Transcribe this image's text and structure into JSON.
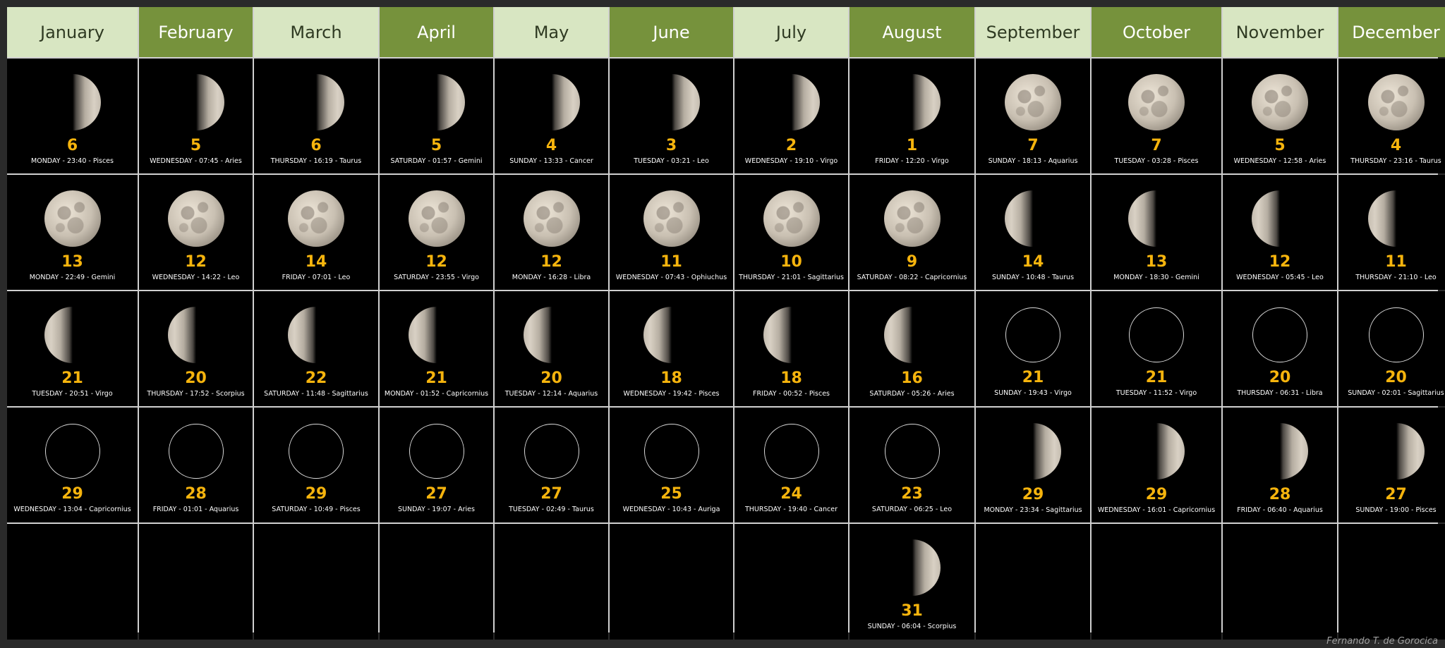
{
  "credit": "Fernando T. de Gorocica",
  "months": [
    {
      "name": "January",
      "style": "light",
      "phases": [
        {
          "day": "6",
          "info": "MONDAY - 23:40 - Pisces",
          "phase": "first"
        },
        {
          "day": "13",
          "info": "MONDAY - 22:49 - Gemini",
          "phase": "full"
        },
        {
          "day": "21",
          "info": "TUESDAY - 20:51 - Virgo",
          "phase": "last"
        },
        {
          "day": "29",
          "info": "WEDNESDAY - 13:04 - Capricornius",
          "phase": "new"
        }
      ]
    },
    {
      "name": "February",
      "style": "dark",
      "phases": [
        {
          "day": "5",
          "info": "WEDNESDAY - 07:45 - Aries",
          "phase": "first"
        },
        {
          "day": "12",
          "info": "WEDNESDAY - 14:22 - Leo",
          "phase": "full"
        },
        {
          "day": "20",
          "info": "THURSDAY - 17:52 - Scorpius",
          "phase": "last"
        },
        {
          "day": "28",
          "info": "FRIDAY - 01:01 - Aquarius",
          "phase": "new"
        }
      ]
    },
    {
      "name": "March",
      "style": "light",
      "phases": [
        {
          "day": "6",
          "info": "THURSDAY - 16:19 - Taurus",
          "phase": "first"
        },
        {
          "day": "14",
          "info": "FRIDAY - 07:01 - Leo",
          "phase": "full"
        },
        {
          "day": "22",
          "info": "SATURDAY - 11:48 - Sagittarius",
          "phase": "last"
        },
        {
          "day": "29",
          "info": "SATURDAY - 10:49 - Pisces",
          "phase": "new"
        }
      ]
    },
    {
      "name": "April",
      "style": "dark",
      "phases": [
        {
          "day": "5",
          "info": "SATURDAY - 01:57 - Gemini",
          "phase": "first"
        },
        {
          "day": "12",
          "info": "SATURDAY - 23:55 - Virgo",
          "phase": "full"
        },
        {
          "day": "21",
          "info": "MONDAY - 01:52 - Capricornius",
          "phase": "last"
        },
        {
          "day": "27",
          "info": "SUNDAY - 19:07 - Aries",
          "phase": "new"
        }
      ]
    },
    {
      "name": "May",
      "style": "light",
      "phases": [
        {
          "day": "4",
          "info": "SUNDAY - 13:33 - Cancer",
          "phase": "first"
        },
        {
          "day": "12",
          "info": "MONDAY - 16:28 - Libra",
          "phase": "full"
        },
        {
          "day": "20",
          "info": "TUESDAY - 12:14 - Aquarius",
          "phase": "last"
        },
        {
          "day": "27",
          "info": "TUESDAY - 02:49 - Taurus",
          "phase": "new"
        }
      ]
    },
    {
      "name": "June",
      "style": "dark",
      "phases": [
        {
          "day": "3",
          "info": "TUESDAY - 03:21 - Leo",
          "phase": "first"
        },
        {
          "day": "11",
          "info": "WEDNESDAY - 07:43 - Ophiuchus",
          "phase": "full"
        },
        {
          "day": "18",
          "info": "WEDNESDAY - 19:42 - Pisces",
          "phase": "last"
        },
        {
          "day": "25",
          "info": "WEDNESDAY - 10:43 - Auriga",
          "phase": "new"
        }
      ]
    },
    {
      "name": "July",
      "style": "light",
      "phases": [
        {
          "day": "2",
          "info": "WEDNESDAY - 19:10 - Virgo",
          "phase": "first"
        },
        {
          "day": "10",
          "info": "THURSDAY - 21:01 - Sagittarius",
          "phase": "full"
        },
        {
          "day": "18",
          "info": "FRIDAY - 00:52 - Pisces",
          "phase": "last"
        },
        {
          "day": "24",
          "info": "THURSDAY - 19:40 - Cancer",
          "phase": "new"
        }
      ]
    },
    {
      "name": "August",
      "style": "dark",
      "phases": [
        {
          "day": "1",
          "info": "FRIDAY - 12:20 - Virgo",
          "phase": "first"
        },
        {
          "day": "9",
          "info": "SATURDAY - 08:22 - Capricornius",
          "phase": "full"
        },
        {
          "day": "16",
          "info": "SATURDAY - 05:26 - Aries",
          "phase": "last"
        },
        {
          "day": "23",
          "info": "SATURDAY - 06:25 - Leo",
          "phase": "new"
        },
        {
          "day": "31",
          "info": "SUNDAY - 06:04 - Scorpius",
          "phase": "first"
        }
      ]
    },
    {
      "name": "September",
      "style": "light",
      "phases": [
        {
          "day": "7",
          "info": "SUNDAY - 18:13 - Aquarius",
          "phase": "full"
        },
        {
          "day": "14",
          "info": "SUNDAY - 10:48 - Taurus",
          "phase": "last"
        },
        {
          "day": "21",
          "info": "SUNDAY - 19:43 - Virgo",
          "phase": "new"
        },
        {
          "day": "29",
          "info": "MONDAY - 23:34 - Sagittarius",
          "phase": "first"
        }
      ]
    },
    {
      "name": "October",
      "style": "dark",
      "phases": [
        {
          "day": "7",
          "info": "TUESDAY - 03:28 - Pisces",
          "phase": "full"
        },
        {
          "day": "13",
          "info": "MONDAY - 18:30 - Gemini",
          "phase": "last"
        },
        {
          "day": "21",
          "info": "TUESDAY - 11:52 - Virgo",
          "phase": "new"
        },
        {
          "day": "29",
          "info": "WEDNESDAY - 16:01 - Capricornius",
          "phase": "first"
        }
      ]
    },
    {
      "name": "November",
      "style": "light",
      "phases": [
        {
          "day": "5",
          "info": "WEDNESDAY - 12:58 - Aries",
          "phase": "full"
        },
        {
          "day": "12",
          "info": "WEDNESDAY - 05:45 - Leo",
          "phase": "last"
        },
        {
          "day": "20",
          "info": "THURSDAY - 06:31 - Libra",
          "phase": "new"
        },
        {
          "day": "28",
          "info": "FRIDAY - 06:40 - Aquarius",
          "phase": "first"
        }
      ]
    },
    {
      "name": "December",
      "style": "dark",
      "phases": [
        {
          "day": "4",
          "info": "THURSDAY - 23:16 - Taurus",
          "phase": "full"
        },
        {
          "day": "11",
          "info": "THURSDAY - 21:10 - Leo",
          "phase": "last"
        },
        {
          "day": "20",
          "info": "SUNDAY - 02:01 - Sagittarius",
          "phase": "new"
        },
        {
          "day": "27",
          "info": "SUNDAY - 19:00 - Pisces",
          "phase": "first"
        }
      ]
    }
  ]
}
